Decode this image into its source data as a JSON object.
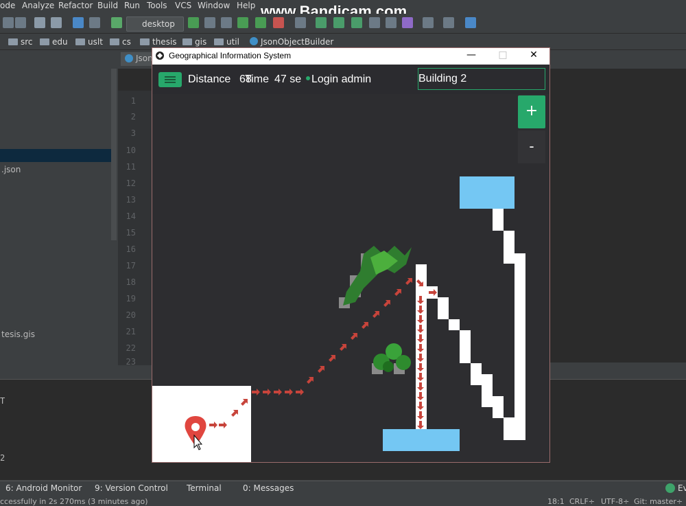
{
  "ide": {
    "menu": [
      "ode",
      "Analyze",
      "Refactor",
      "Build",
      "Run",
      "Tools",
      "VCS",
      "Window",
      "Help"
    ],
    "watermark": "www.Bandicam.com",
    "run_config": "desktop",
    "breadcrumbs": [
      "src",
      "edu",
      "uslt",
      "cs",
      "thesis",
      "gis",
      "util",
      "JsonObjectBuilder"
    ],
    "editor_tab": "Json",
    "project_files": [
      ".json",
      "tesis.gis"
    ],
    "line_numbers": [
      "1",
      "2",
      "3",
      "10",
      "11",
      "12",
      "13",
      "14",
      "15",
      "16",
      "17",
      "18",
      "19",
      "20",
      "21",
      "22",
      "23"
    ],
    "bottom_chars": [
      "T",
      "2"
    ],
    "tool_tabs": [
      "6: Android Monitor",
      "9: Version Control",
      "Terminal",
      "0: Messages"
    ],
    "status_message": "ccessfully in 2s 270ms (3 minutes ago)",
    "status_right": [
      "18:1",
      "CRLF÷",
      "UTF-8÷",
      "Git: master÷"
    ],
    "event_log": "Ev"
  },
  "gis": {
    "window_title": "Geographical Information System",
    "header": {
      "distance_label": "Distance",
      "distance_value": "68",
      "time_label": "Time",
      "time_value": "47 se",
      "login": "Login admin"
    },
    "search": {
      "value": "Building 2"
    },
    "zoom": {
      "in_label": "+",
      "out_label": "-"
    },
    "colors": {
      "accent": "#27a86b",
      "building": "#74c7f3",
      "route_arrow": "#c7443b",
      "marker": "#e0463f",
      "path": "#ffffff",
      "map_bg": "#2d2d30"
    }
  }
}
